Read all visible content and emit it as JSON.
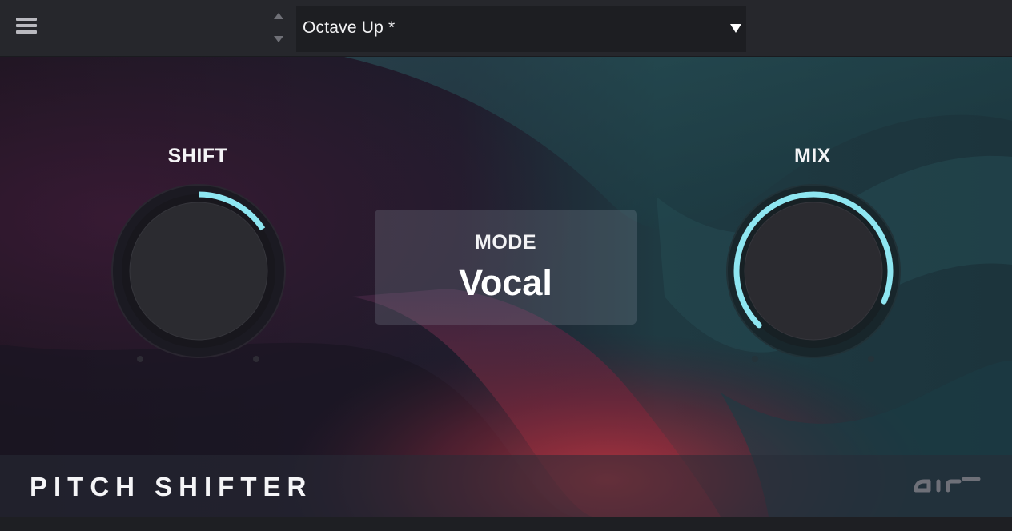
{
  "topbar": {
    "menu_icon": "hamburger-menu-icon",
    "preset_prev_icon": "triangle-up-icon",
    "preset_next_icon": "triangle-down-icon",
    "preset_name": "Octave Up *",
    "preset_dropdown_icon": "caret-down-icon"
  },
  "controls": {
    "shift": {
      "label": "SHIFT",
      "value_fraction": 0.21
    },
    "mix": {
      "label": "MIX",
      "value_fraction": 0.92
    },
    "mode": {
      "label": "MODE",
      "value": "Vocal"
    }
  },
  "footer": {
    "plugin_name": "PITCH SHIFTER",
    "brand_logo": "air-logo"
  },
  "colors": {
    "accent": "#8ee6f1",
    "knob_body": "#2b2b30",
    "topbar": "#26272c",
    "text": "#f4f4f6"
  }
}
